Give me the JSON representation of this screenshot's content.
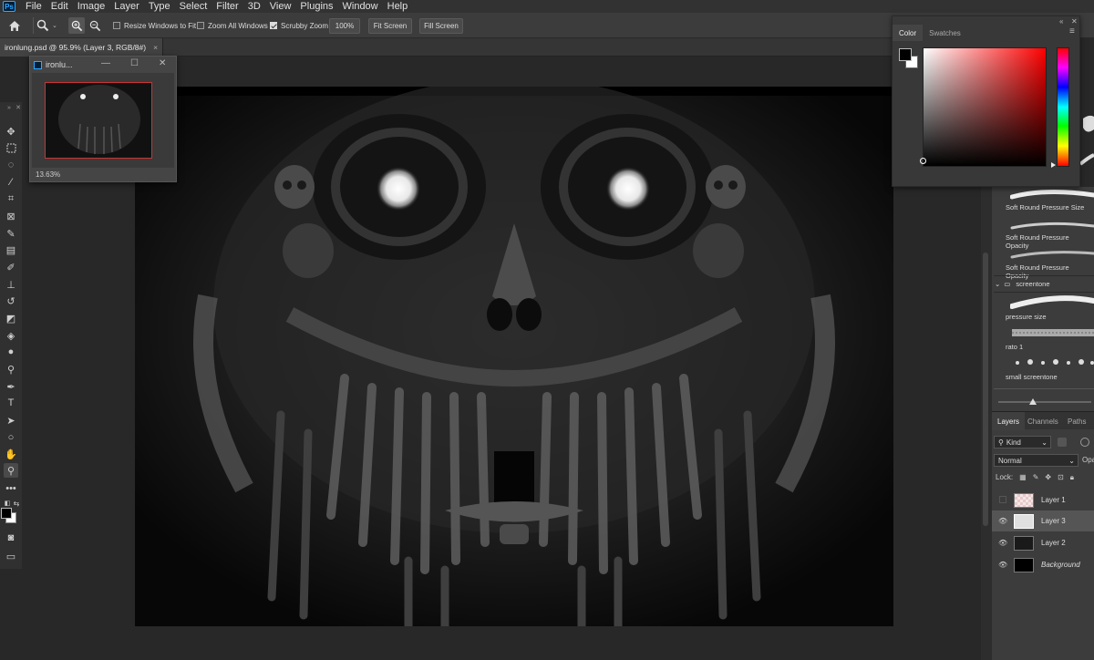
{
  "menu": [
    "File",
    "Edit",
    "Image",
    "Layer",
    "Type",
    "Select",
    "Filter",
    "3D",
    "View",
    "Plugins",
    "Window",
    "Help"
  ],
  "app_logo": "Ps",
  "options": {
    "resize_windows": "Resize Windows to Fit",
    "zoom_all": "Zoom All Windows",
    "scrubby": "Scrubby Zoom",
    "zoom_value": "100%",
    "fit_screen": "Fit Screen",
    "fill_screen": "Fill Screen"
  },
  "document_tab": {
    "title": "ironlung.psd @ 95.9% (Layer 3, RGB/8#)",
    "close": "×"
  },
  "navigator": {
    "title": "ironlu...",
    "zoom": "13.63%"
  },
  "color_panel": {
    "tabs": [
      "Color",
      "Swatches"
    ],
    "foreground": "#000000",
    "background": "#ffffff"
  },
  "brushes": [
    {
      "label": "Soft Round Pressure Size"
    },
    {
      "label": "Soft Round Pressure Opacity"
    },
    {
      "label": "Soft Round Pressure Opacity"
    },
    {
      "label": "screentone",
      "is_folder": true
    },
    {
      "label": "pressure size"
    },
    {
      "label": "rato 1"
    },
    {
      "label": "small screentone"
    }
  ],
  "layers_panel": {
    "tabs": [
      "Layers",
      "Channels",
      "Paths"
    ],
    "kind_filter": "Kind",
    "blend_mode": "Normal",
    "opacity_label": "Opa",
    "lock_label": "Lock:",
    "layers": [
      {
        "name": "Layer 1",
        "visible": false
      },
      {
        "name": "Layer 3",
        "visible": true,
        "selected": true
      },
      {
        "name": "Layer 2",
        "visible": true
      },
      {
        "name": "Background",
        "visible": true,
        "italic": true
      }
    ]
  },
  "icons": {
    "home": "home-icon",
    "zoom": "zoom-tool-icon",
    "zoom_in": "zoom-in-icon",
    "zoom_out": "zoom-out-icon"
  }
}
